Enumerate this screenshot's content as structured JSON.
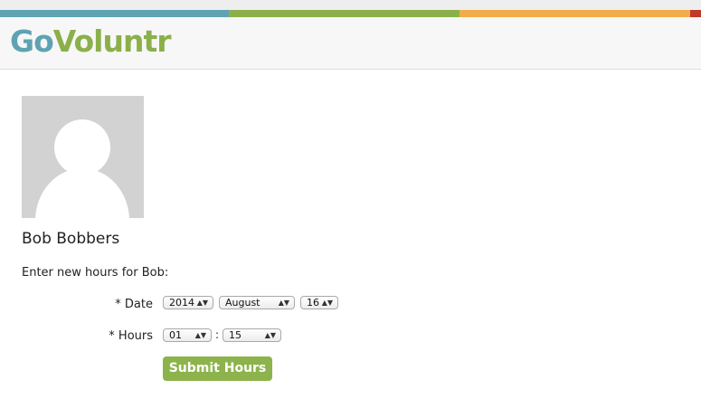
{
  "brand": {
    "logo_part1": "Go",
    "logo_part2": "Voluntr",
    "colors": [
      "#5fa3b3",
      "#8bb04a",
      "#f2ad4b",
      "#c0392b"
    ]
  },
  "profile": {
    "name": "Bob Bobbers",
    "avatar": "default-avatar-icon"
  },
  "form": {
    "prompt": "Enter new hours for Bob:",
    "date_label": "* Date",
    "year": "2014",
    "month": "August",
    "day": "16",
    "hours_label": "* Hours",
    "hours": "01",
    "colon": ":",
    "minutes": "15",
    "submit_label": "Submit Hours"
  }
}
